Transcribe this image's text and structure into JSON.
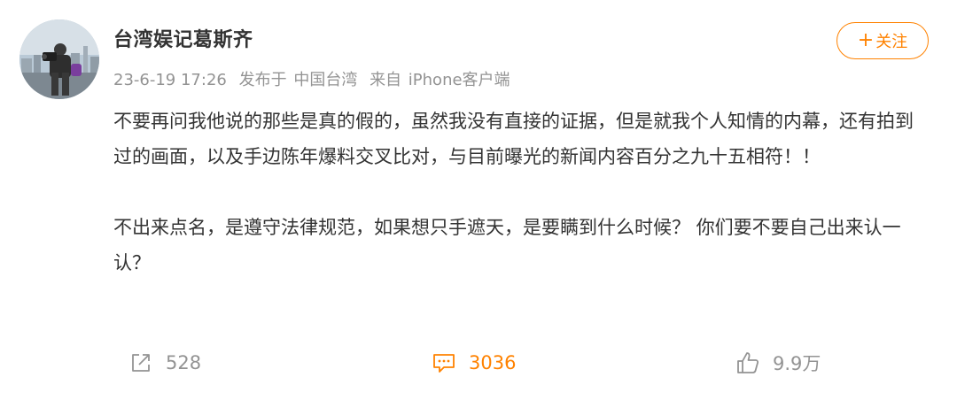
{
  "author": {
    "name": "台湾娱记葛斯齐",
    "follow_label": "关注"
  },
  "meta": {
    "time": "23-6-19 17:26",
    "published_at_prefix": "发布于",
    "location": "中国台湾",
    "source_prefix": "来自",
    "source": "iPhone客户端"
  },
  "content": {
    "paragraph1": "不要再问我他说的那些是真的假的，虽然我没有直接的证据，但是就我个人知情的内幕，还有拍到过的画面，以及手边陈年爆料交叉比对，与目前曝光的新闻内容百分之九十五相符！！",
    "paragraph2": "不出来点名，是遵守法律规范，如果想只手遮天，是要瞒到什么时候？ 你们要不要自己出来认一认？"
  },
  "actions": {
    "share_count": "528",
    "comment_count": "3036",
    "like_count": "9.9万"
  },
  "icons": {
    "share": "share-icon",
    "comment": "comment-icon",
    "like": "like-icon",
    "plus": "plus-icon"
  },
  "colors": {
    "accent": "#ff8200",
    "text": "#333333",
    "muted": "#939393"
  }
}
